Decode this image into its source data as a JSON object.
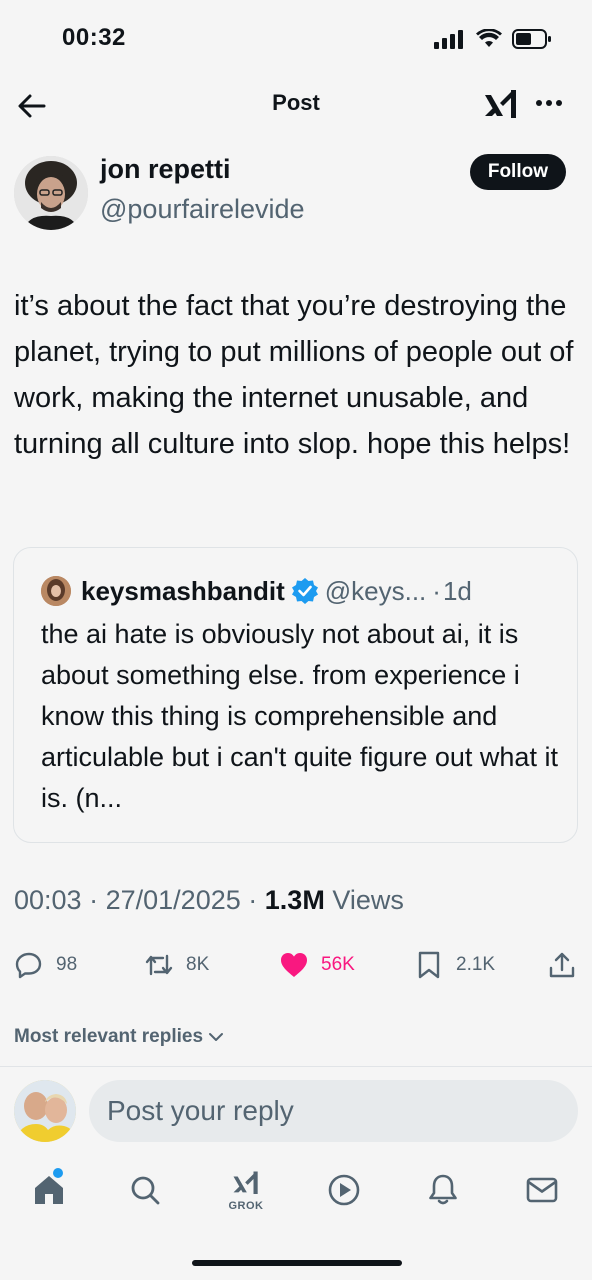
{
  "status_bar": {
    "time": "00:32"
  },
  "header": {
    "title": "Post"
  },
  "author": {
    "name": "jon repetti",
    "handle": "@pourfairelevide",
    "follow_label": "Follow"
  },
  "post": {
    "text": "it’s about the fact that you’re destroying the planet, trying to put millions of people out of work, making the internet unusable, and turning all culture into slop. hope this helps!"
  },
  "quoted_post": {
    "name": "keysmashbandit",
    "handle": "@keys...",
    "separator": "·",
    "age": "1d",
    "text": "the ai hate is obviously not about ai, it is about something else. from experience i know this thing is comprehensible and articulable but i can't quite figure out what it is. (n..."
  },
  "meta": {
    "time": "00:03",
    "date": "27/01/2025",
    "views_count": "1.3M",
    "views_label": "Views",
    "sep": "·"
  },
  "actions": {
    "replies": "98",
    "reposts": "8K",
    "likes": "56K",
    "bookmarks": "2.1K"
  },
  "replies_filter": {
    "label": "Most relevant replies"
  },
  "reply": {
    "placeholder": "Post your reply"
  },
  "tabbar": {
    "grok_label": "GROK"
  },
  "colors": {
    "text": "#0f1419",
    "secondary": "#536471",
    "like": "#f91880",
    "verified": "#1d9bf0",
    "background": "#f5f5f5"
  },
  "icons": [
    "back-arrow-icon",
    "xai-logo-icon",
    "more-icon",
    "verified-icon",
    "reply-icon",
    "repost-icon",
    "heart-icon",
    "bookmark-icon",
    "share-icon",
    "chevron-down-icon",
    "home-icon",
    "search-icon",
    "grok-icon",
    "video-icon",
    "bell-icon",
    "mail-icon"
  ]
}
